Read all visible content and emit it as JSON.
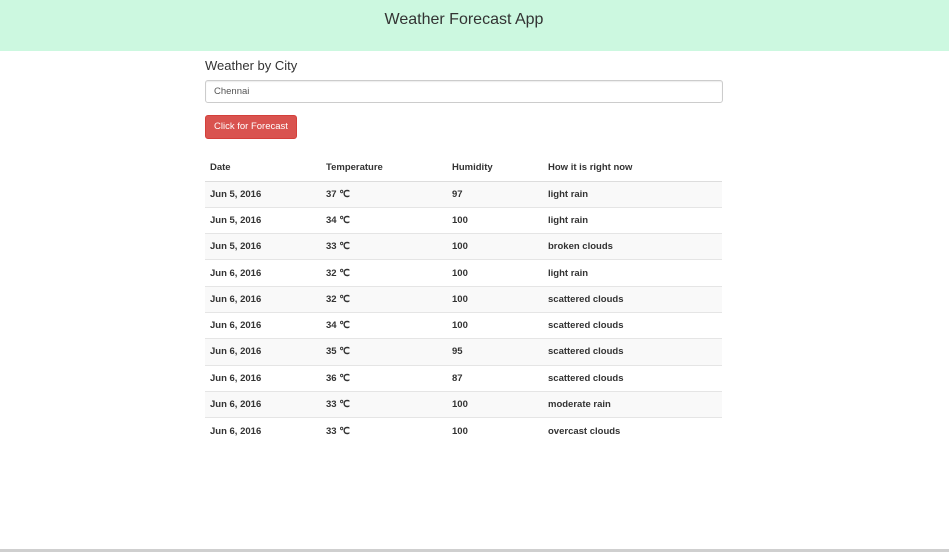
{
  "header": {
    "title": "Weather Forecast App",
    "background": "#ccf8e0"
  },
  "search": {
    "section_title": "Weather by City",
    "city_value": "Chennai",
    "button_label": "Click for Forecast",
    "button_color": "#d9534f"
  },
  "table": {
    "columns": [
      "Date",
      "Temperature",
      "Humidity",
      "How it is right now"
    ],
    "rows": [
      [
        "Jun 5, 2016",
        "37 ℃",
        "97",
        "light rain"
      ],
      [
        "Jun 5, 2016",
        "34 ℃",
        "100",
        "light rain"
      ],
      [
        "Jun 5, 2016",
        "33 ℃",
        "100",
        "broken clouds"
      ],
      [
        "Jun 6, 2016",
        "32 ℃",
        "100",
        "light rain"
      ],
      [
        "Jun 6, 2016",
        "32 ℃",
        "100",
        "scattered clouds"
      ],
      [
        "Jun 6, 2016",
        "34 ℃",
        "100",
        "scattered clouds"
      ],
      [
        "Jun 6, 2016",
        "35 ℃",
        "95",
        "scattered clouds"
      ],
      [
        "Jun 6, 2016",
        "36 ℃",
        "87",
        "scattered clouds"
      ],
      [
        "Jun 6, 2016",
        "33 ℃",
        "100",
        "moderate rain"
      ],
      [
        "Jun 6, 2016",
        "33 ℃",
        "100",
        "overcast clouds"
      ]
    ]
  }
}
